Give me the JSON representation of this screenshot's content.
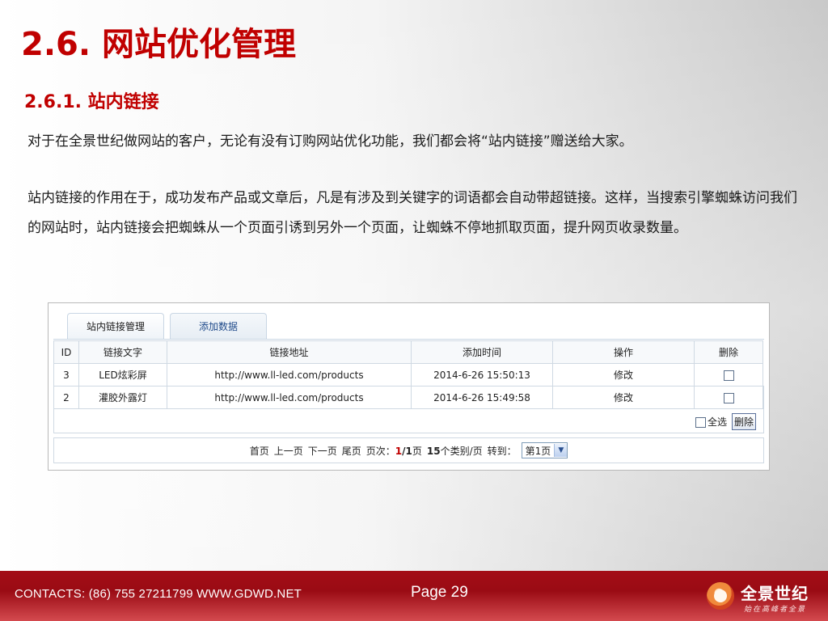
{
  "title": "2.6. 网站优化管理",
  "subtitle": "2.6.1. 站内链接",
  "paragraph1": "对于在全景世纪做网站的客户，无论有没有订购网站优化功能，我们都会将“站内链接”赠送给大家。",
  "paragraph2": "站内链接的作用在于，成功发布产品或文章后，凡是有涉及到关键字的词语都会自动带超链接。这样，当搜索引擎蜘蛛访问我们的网站时，站内链接会把蜘蛛从一个页面引诱到另外一个页面，让蜘蛛不停地抓取页面，提升网页收录数量。",
  "screenshot": {
    "tabs": [
      "站内链接管理",
      "添加数据"
    ],
    "columns": [
      "ID",
      "链接文字",
      "链接地址",
      "添加时间",
      "操作",
      "删除"
    ],
    "rows": [
      {
        "id": "3",
        "text": "LED炫彩屏",
        "url": "http://www.ll-led.com/products",
        "time": "2014-6-26 15:50:13",
        "op": "修改"
      },
      {
        "id": "2",
        "text": "灌胶外露灯",
        "url": "http://www.ll-led.com/products",
        "time": "2014-6-26 15:49:58",
        "op": "修改"
      }
    ],
    "select_all": "全选",
    "delete": "删除",
    "pager": {
      "first": "首页",
      "prev": "上一页",
      "next": "下一页",
      "last": "尾页",
      "pages_label": "页次：",
      "current": "1",
      "total": "/1",
      "page_unit": "页",
      "per_page": "15",
      "per_page_label": "个类别/页",
      "goto_label": "转到：",
      "selected_page": "第1页"
    }
  },
  "footer": {
    "contacts": "CONTACTS: (86) 755 27211799 WWW.GDWD.NET",
    "page": "Page 29",
    "logo_name": "全景世纪",
    "logo_slogan": "始在高峰者全景"
  },
  "colors": {
    "accent": "#c00000",
    "footer": "#a30d16"
  }
}
